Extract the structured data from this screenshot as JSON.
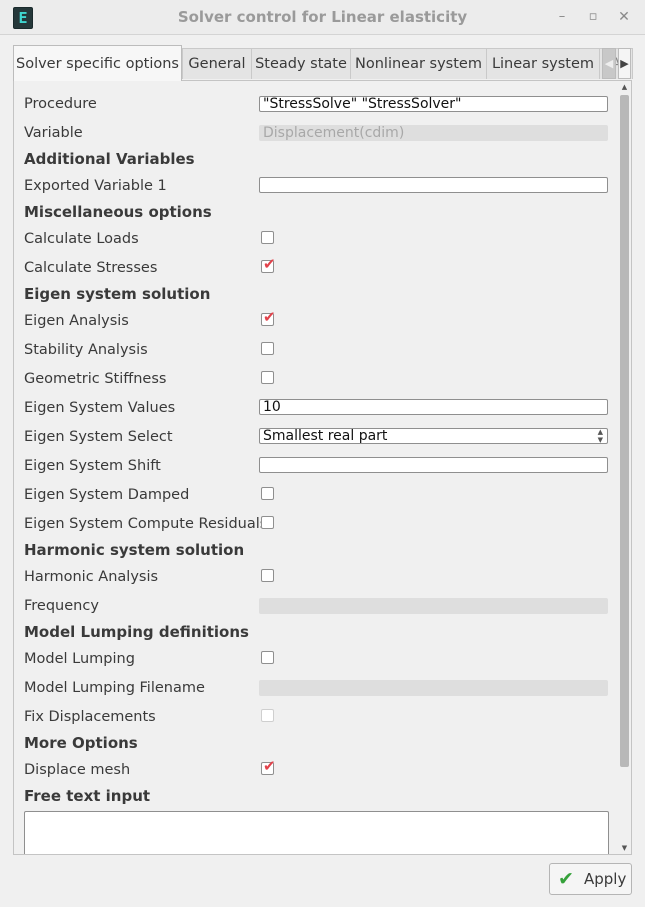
{
  "window": {
    "title": "Solver control for Linear elasticity",
    "app_icon_glyph": "E",
    "controls": {
      "minimize": "–",
      "maximize": "▫",
      "close": "✕"
    }
  },
  "tabs": [
    {
      "label": "Solver specific options",
      "active": true
    },
    {
      "label": "General",
      "active": false
    },
    {
      "label": "Steady state",
      "active": false
    },
    {
      "label": "Nonlinear system",
      "active": false
    },
    {
      "label": "Linear system",
      "active": false
    },
    {
      "label": "A",
      "active": false
    }
  ],
  "tab_scroll": {
    "left": "◀",
    "right": "▶"
  },
  "form": {
    "procedure": {
      "label": "Procedure",
      "value": "\"StressSolve\" \"StressSolver\""
    },
    "variable": {
      "label": "Variable",
      "value": "Displacement(cdim)"
    },
    "additional_variables": {
      "heading": "Additional Variables",
      "exported_variable_1": {
        "label": "Exported Variable 1",
        "value": ""
      }
    },
    "miscellaneous": {
      "heading": "Miscellaneous options",
      "calculate_loads": {
        "label": "Calculate Loads",
        "checked": false
      },
      "calculate_stresses": {
        "label": "Calculate Stresses",
        "checked": true
      }
    },
    "eigen": {
      "heading": "Eigen system solution",
      "eigen_analysis": {
        "label": "Eigen Analysis",
        "checked": true
      },
      "stability_analysis": {
        "label": "Stability Analysis",
        "checked": false
      },
      "geometric_stiffness": {
        "label": "Geometric Stiffness",
        "checked": false
      },
      "eigen_system_values": {
        "label": "Eigen System Values",
        "value": "10"
      },
      "eigen_system_select": {
        "label": "Eigen System Select",
        "value": "Smallest real part"
      },
      "eigen_system_shift": {
        "label": "Eigen System Shift",
        "value": ""
      },
      "eigen_system_damped": {
        "label": "Eigen System Damped",
        "checked": false
      },
      "eigen_system_compute_residuals": {
        "label": "Eigen System Compute Residuals",
        "checked": false
      }
    },
    "harmonic": {
      "heading": "Harmonic system solution",
      "harmonic_analysis": {
        "label": "Harmonic Analysis",
        "checked": false
      },
      "frequency": {
        "label": "Frequency",
        "value": ""
      }
    },
    "model_lumping": {
      "heading": "Model Lumping definitions",
      "model_lumping": {
        "label": "Model Lumping",
        "checked": false
      },
      "model_lumping_filename": {
        "label": "Model Lumping Filename",
        "value": ""
      },
      "fix_displacements": {
        "label": "Fix Displacements",
        "checked": false
      }
    },
    "more_options": {
      "heading": "More Options",
      "displace_mesh": {
        "label": "Displace mesh",
        "checked": true
      }
    },
    "free_text": {
      "heading": "Free text input",
      "value": ""
    }
  },
  "icons": {
    "check_mark": "✔",
    "checkbox_tick": "✔",
    "scroll_up": "▲",
    "scroll_down": "▼",
    "select_arrows": "▲▼"
  },
  "apply_button": {
    "label": "Apply"
  },
  "colors": {
    "accent_check": "#e2424b",
    "apply_check": "#35a13a",
    "app_icon": "#3fd6d0"
  }
}
